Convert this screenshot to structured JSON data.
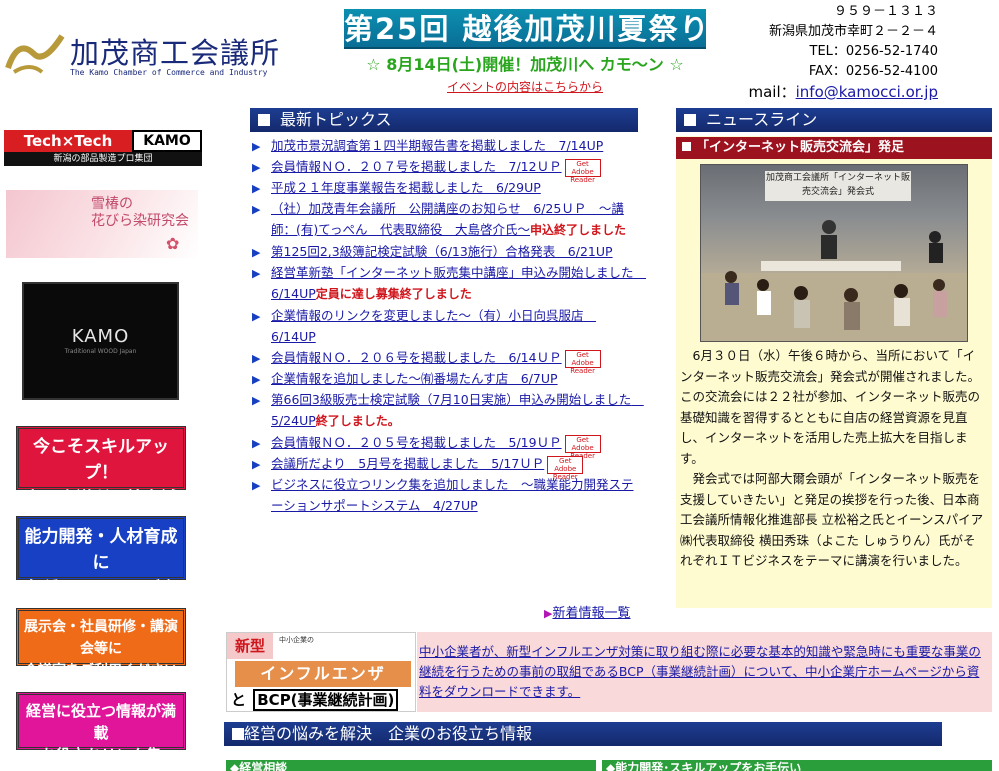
{
  "header": {
    "logo_text": "加茂商工会議所",
    "logo_sub": "The Kamo Chamber of Commerce and Industry",
    "banner": "第25回 越後加茂川夏祭り",
    "banner_sub": "☆ 8月14日(土)開催！加茂川へ カモ〜ン ☆",
    "event_link": "イベントの内容はこちらから",
    "postal": "９５９－１３１３",
    "address": "新潟県加茂市幸町２－２－４",
    "tel": "TEL：0256-52-1740",
    "fax": "FAX：0256-52-4100",
    "mail_label": "mail：",
    "mail": "info@kamocci.or.jp"
  },
  "sidebar": {
    "techtech": {
      "red": "Tech×Tech",
      "box": "KAMO",
      "sub": "新潟の部品製造プロ集団"
    },
    "tsubaki": {
      "line1": "雪椿の",
      "line2": "花びら染研究会"
    },
    "kamo": {
      "title": "KAMO",
      "sub": "Traditional WOOD Japan"
    },
    "btn1": {
      "line1": "今こそスキルアップ！",
      "line2": "商工会議所の検定試験"
    },
    "btn2": {
      "line1": "能力開発・人材育成に",
      "line2": "各種セミナーのご案内"
    },
    "btn3": {
      "line1": "展示会・社員研修・講演会等に",
      "line2": "会議室をご利用ください"
    },
    "btn4": {
      "line1": "経営に役立つ情報が満載",
      "line2": "お役立ちリンク集"
    }
  },
  "topics": {
    "heading": "最新トピックス",
    "items": [
      {
        "text": "加茂市景況調査第１四半期報告書を掲載しました　7/14UP",
        "red": "",
        "adobe": false
      },
      {
        "text": "会員情報ＮＯ．２０７号を掲載しました　7/12ＵＰ",
        "red": "",
        "adobe": true
      },
      {
        "text": "平成２１年度事業報告を掲載しました　6/29UP",
        "red": "",
        "adobe": false
      },
      {
        "text": "（社）加茂青年会議所　公開講座のお知らせ　6/25ＵＰ　〜講師：(有)てっぺん　代表取締役　大島啓介氏〜",
        "red": "申込終了しました",
        "adobe": false
      },
      {
        "text": "第125回2,3級簿記検定試験（6/13施行）合格発表　6/21UP",
        "red": "",
        "adobe": false
      },
      {
        "text": "経営革新塾「インターネット販売集中講座」申込み開始しました　6/14UP",
        "red": "定員に達し募集終了しました",
        "adobe": false
      },
      {
        "text": "企業情報のリンクを変更しました〜（有）小日向呉服店　6/14UP",
        "red": "",
        "adobe": false
      },
      {
        "text": "会員情報ＮＯ．２０６号を掲載しました　6/14ＵＰ",
        "red": "",
        "adobe": true
      },
      {
        "text": "企業情報を追加しました〜㈲番場たんす店　6/7UP",
        "red": "",
        "adobe": false
      },
      {
        "text": "第66回3級販売士検定試験（7月10日実施）申込み開始しました　5/24UP",
        "red": "終了しました。",
        "adobe": false
      },
      {
        "text": "会員情報ＮＯ．２０５号を掲載しました　5/19ＵＰ",
        "red": "",
        "adobe": true
      },
      {
        "text": "会議所だより　5月号を掲載しました　5/17ＵＰ",
        "red": "",
        "adobe": true
      },
      {
        "text": "ビジネスに役立つリンク集を追加しました　〜職業能力開発ステーションサポートシステム　4/27UP",
        "red": "",
        "adobe": false
      }
    ],
    "more": "新着情報一覧"
  },
  "news": {
    "heading": "ニュースライン",
    "title": "「インターネット販売交流会」発足",
    "photo_caption": "加茂商工会議所「インターネット販売交流会」発会式",
    "p1": "　6月３０日（水）午後６時から、当所において「インターネット販売交流会」発会式が開催されました。",
    "p2": "この交流会には２２社が参加、インターネット販売の基礎知識を習得するとともに自店の経営資源を見直し、インターネットを活用した売上拡大を目指します。",
    "p3": "　発会式では阿部大爾会頭が「インターネット販売を支援していきたい」と発足の挨拶を行った後、日本商工会議所情報化推進部長 立松裕之氏とイーンスパイア㈱代表取締役 横田秀珠（よこた しゅうりん）氏がそれぞれＩＴビジネスをテーマに講演を行いました。"
  },
  "flu": {
    "shin": "新型",
    "inf": "インフルエンザ",
    "to": "と",
    "bcp": "BCP(事業継続計画)",
    "mini": "中小企業の",
    "text": "中小企業者が、新型インフルエンザ対策に取り組む際に必要な基本的知識や緊急時にも重要な事業の継続を行うための事前の取組であるBCP（事業継続計画）について、中小企業庁ホームページから資料をダウンロードできます。"
  },
  "bottom": {
    "heading": "経営の悩みを解決　企業のお役立ち情報",
    "sub1": "◆経営相談",
    "sub2": "◆能力開発･スキルアップをお手伝い"
  },
  "adobe_label": "Get Adobe Reader",
  "colors": {
    "navy": "#14296c",
    "accent_red": "#d0161d",
    "link": "#1a1aa6"
  }
}
